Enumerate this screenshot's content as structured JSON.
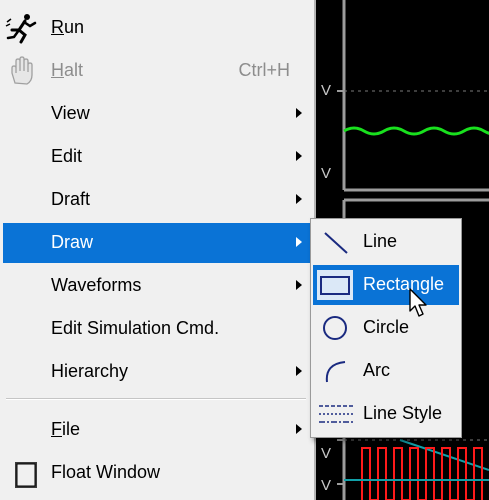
{
  "main_menu": {
    "items": [
      {
        "label": "Run",
        "icon": "running-man-icon"
      },
      {
        "label": "Halt",
        "shortcut": "Ctrl+H",
        "icon": "hand-icon",
        "disabled": true
      },
      {
        "label": "View",
        "submenu": true
      },
      {
        "label": "Edit",
        "submenu": true
      },
      {
        "label": "Draft",
        "submenu": true
      },
      {
        "label": "Draw",
        "submenu": true,
        "highlighted": true
      },
      {
        "label": "Waveforms",
        "submenu": true
      },
      {
        "label": "Edit Simulation Cmd."
      },
      {
        "label": "Hierarchy",
        "submenu": true
      },
      {
        "label": "File",
        "submenu": true
      },
      {
        "label": "Float Window",
        "icon": "window-icon"
      }
    ]
  },
  "draw_submenu": {
    "items": [
      {
        "label": "Line",
        "icon": "line-icon"
      },
      {
        "label": "Rectangle",
        "icon": "rectangle-icon",
        "highlighted": true
      },
      {
        "label": "Circle",
        "icon": "circle-icon"
      },
      {
        "label": "Arc",
        "icon": "arc-icon"
      },
      {
        "label": "Line Style",
        "icon": "line-style-icon"
      }
    ]
  },
  "background": {
    "axis_label": "V",
    "colors": {
      "waveform_green": "#19e01e",
      "waveform_red": "#ff1a1a",
      "waveform_teal": "#11a0a8",
      "plot_frame": "#9c9c9c",
      "menu_highlight": "#0a73d6"
    }
  }
}
